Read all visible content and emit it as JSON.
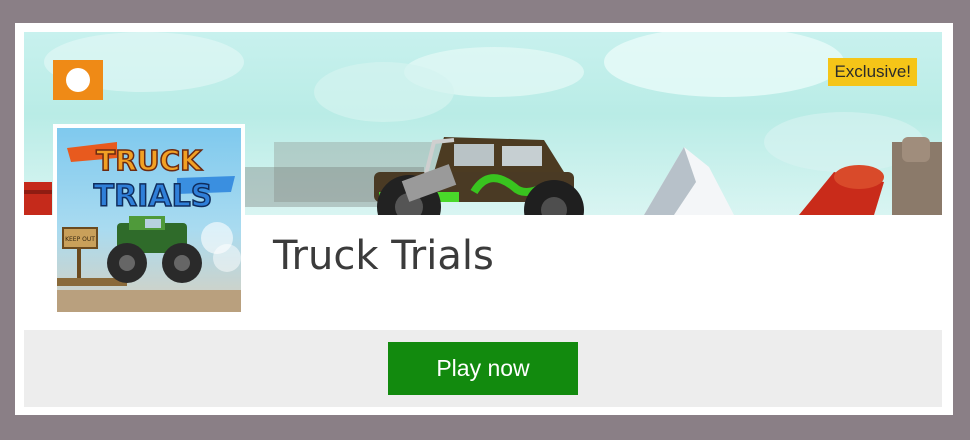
{
  "game": {
    "title": "Truck Trials",
    "badge": "Exclusive!",
    "cover_logo_line1": "TRUCK",
    "cover_logo_line2": "TRIALS",
    "cover_sign": "KEEP OUT"
  },
  "actions": {
    "play_label": "Play now"
  },
  "icons": {
    "back": "chevron-left-icon"
  },
  "colors": {
    "back_button": "#ef8a16",
    "badge": "#f5c518",
    "play_button": "#128a0e",
    "action_bar": "#ededed",
    "page_background": "#8a7f86"
  }
}
